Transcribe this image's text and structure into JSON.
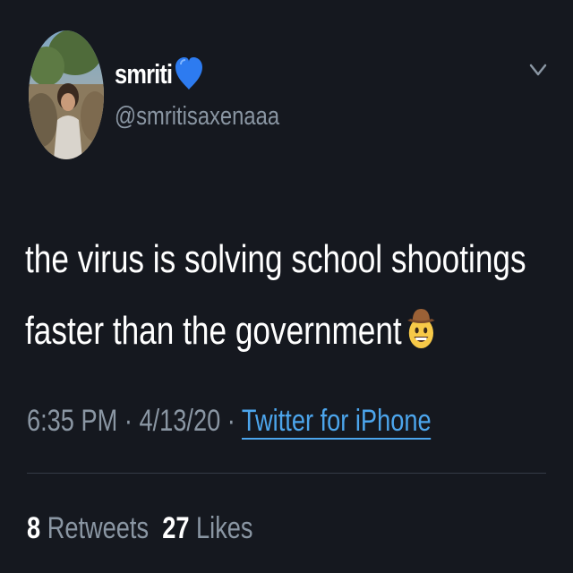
{
  "tweet": {
    "display_name": "smriti",
    "handle": "@smritisaxenaaa",
    "text_line1": "the virus is solving school shootings",
    "text_line2": "faster than the government",
    "time": "6:35 PM",
    "separator1": " · ",
    "date": "4/13/20",
    "separator2": " · ",
    "source": "Twitter for iPhone",
    "retweets_count": "8",
    "retweets_label": "Retweets",
    "likes_count": "27",
    "likes_label": "Likes"
  },
  "icons": {
    "heart": "blue-heart-icon",
    "emoji": "cowboy-hat-face-icon",
    "menu": "chevron-down-icon"
  },
  "colors": {
    "background": "#15181f",
    "text": "#ffffff",
    "secondary": "#8a96a3",
    "link": "#4ca5ec",
    "heart": "#2d7bf0"
  }
}
